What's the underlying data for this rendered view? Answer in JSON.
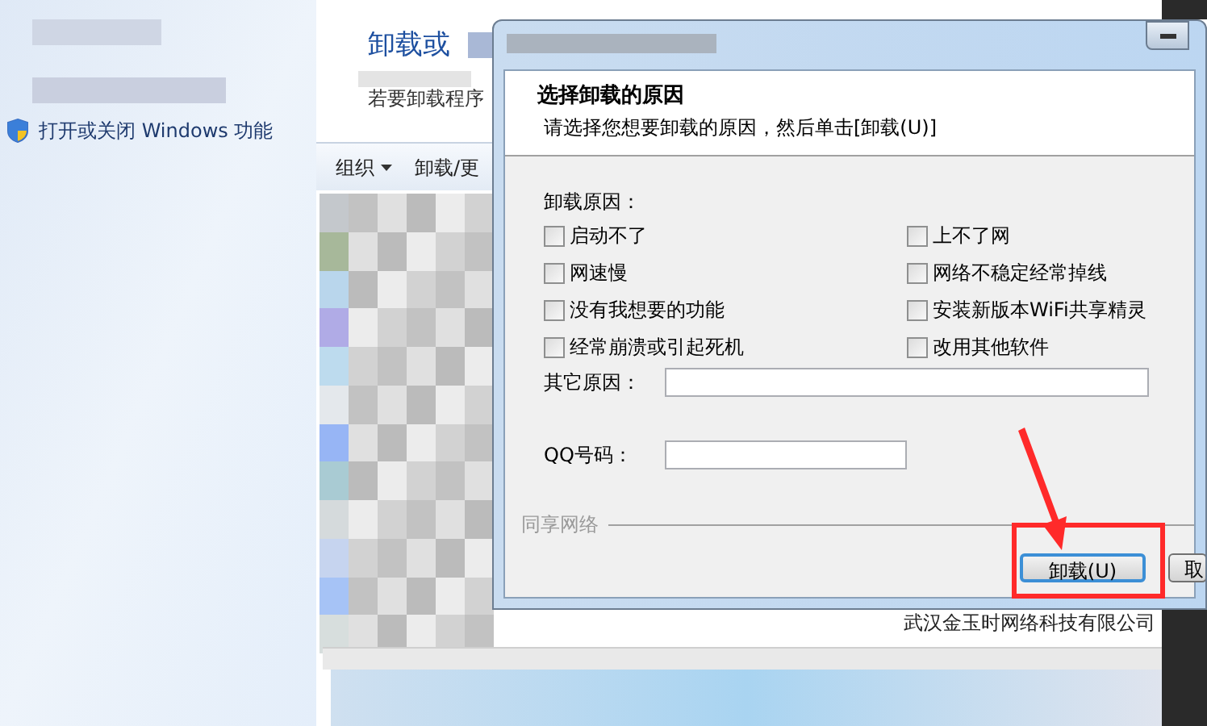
{
  "sidebar": {
    "link": "打开或关闭 Windows 功能"
  },
  "explorer": {
    "title": "卸载或",
    "subtitle": "若要卸载程序",
    "toolbar": [
      {
        "label": "组织",
        "dropdown": true
      },
      {
        "label": "卸载/更",
        "dropdown": false
      }
    ],
    "publisher": "武汉金玉时网络科技有限公司"
  },
  "dialog": {
    "heading": "选择卸载的原因",
    "instruction": "请选择您想要卸载的原因，然后单击[卸载(U)]",
    "reasons_label": "卸载原因：",
    "reasons": [
      {
        "label": "启动不了",
        "checked": false
      },
      {
        "label": "上不了网",
        "checked": false
      },
      {
        "label": "网速慢",
        "checked": false
      },
      {
        "label": "网络不稳定经常掉线",
        "checked": false
      },
      {
        "label": "没有我想要的功能",
        "checked": false
      },
      {
        "label": "安装新版本WiFi共享精灵",
        "checked": false
      },
      {
        "label": "经常崩溃或引起死机",
        "checked": false
      },
      {
        "label": "改用其他软件",
        "checked": false
      }
    ],
    "other_label": "其它原因：",
    "qq_label": "QQ号码：",
    "group_label": "同享网络",
    "buttons": [
      {
        "label": "卸载(U)",
        "focused": true
      },
      {
        "label": "取",
        "focused": false
      }
    ]
  }
}
